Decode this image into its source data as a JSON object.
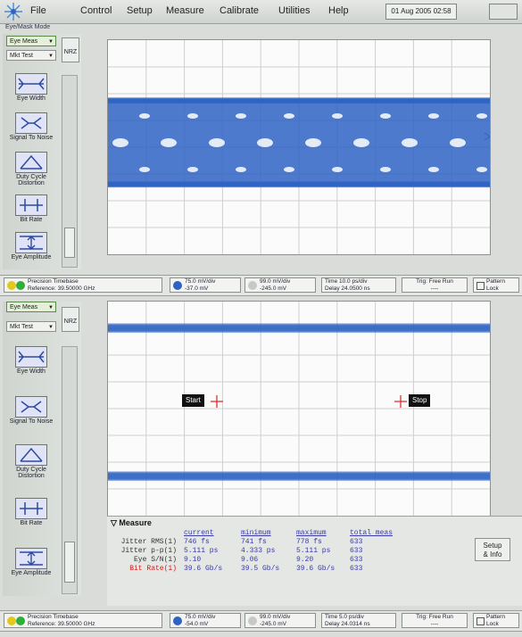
{
  "menu": {
    "items": [
      "File",
      "Control",
      "Setup",
      "Measure",
      "Calibrate",
      "Utilities",
      "Help"
    ],
    "clock": "01 Aug 2005  02:58"
  },
  "mode_label": "Eye/Mask Mode",
  "panel_top": {
    "mode_dropdown": "Eye Meas",
    "test_dropdown": "Mkt Test",
    "nrz": "NRZ",
    "buttons": [
      "Eye Width",
      "Signal To Noise",
      "Duty Cycle Distortion",
      "Bit Rate",
      "Eye Amplitude"
    ]
  },
  "panel_bottom": {
    "mode_dropdown": "Eye Meas",
    "test_dropdown": "Mkt Test",
    "nrz": "NRZ",
    "buttons": [
      "Eye Width",
      "Signal To Noise",
      "Duty Cycle Distortion",
      "Bit Rate",
      "Eye Amplitude"
    ]
  },
  "status_top": {
    "timebase": [
      "Precision Timebase",
      "Reference: 39.50000 GHz"
    ],
    "ch1": [
      "75.0 mV/div",
      "-37.0 mV"
    ],
    "ch2": [
      "99.0 mV/div",
      "-245.0 mV"
    ],
    "time": [
      "Time 10.0 ps/div",
      "Delay 24.0500 ns"
    ],
    "trig": [
      "Trig: Free Run",
      "----"
    ],
    "pattern": [
      "Pattern",
      "Lock"
    ]
  },
  "status_bottom": {
    "timebase": [
      "Precision Timebase",
      "Reference: 39.50000 GHz"
    ],
    "ch1": [
      "75.0 mV/div",
      "-54.0 mV"
    ],
    "ch2": [
      "99.0 mV/div",
      "-245.0 mV"
    ],
    "time": [
      "Time 5.0 ps/div",
      "Delay 24.0314 ns"
    ],
    "trig": [
      "Trig: Free Run",
      "----"
    ],
    "pattern": [
      "Pattern",
      "Lock"
    ]
  },
  "markers": {
    "start": "Start",
    "stop": "Stop"
  },
  "measure": {
    "tab": "Measure",
    "headers": [
      "current",
      "minimum",
      "maximum",
      "total meas"
    ],
    "rows": [
      {
        "label": "Jitter RMS(1)",
        "current": "746 fs",
        "minimum": "741 fs",
        "maximum": "778 fs",
        "total": "633",
        "alert": false
      },
      {
        "label": "Jitter p-p(1)",
        "current": "5.111 ps",
        "minimum": "4.333 ps",
        "maximum": "5.111 ps",
        "total": "633",
        "alert": false
      },
      {
        "label": "Eye S/N(1)",
        "current": "9.10",
        "minimum": "9.06",
        "maximum": "9.20",
        "total": "633",
        "alert": false
      },
      {
        "label": "Bit Rate(1)",
        "current": "39.6 Gb/s",
        "minimum": "39.5 Gb/s",
        "maximum": "39.6 Gb/s",
        "total": "633",
        "alert": true
      }
    ],
    "setup_button": [
      "Setup",
      "& Info"
    ]
  },
  "colors": {
    "trace": "#2e63c4",
    "trace_light": "#7aa3de",
    "grid": "#c9c9c9",
    "marker": "#e03030"
  }
}
